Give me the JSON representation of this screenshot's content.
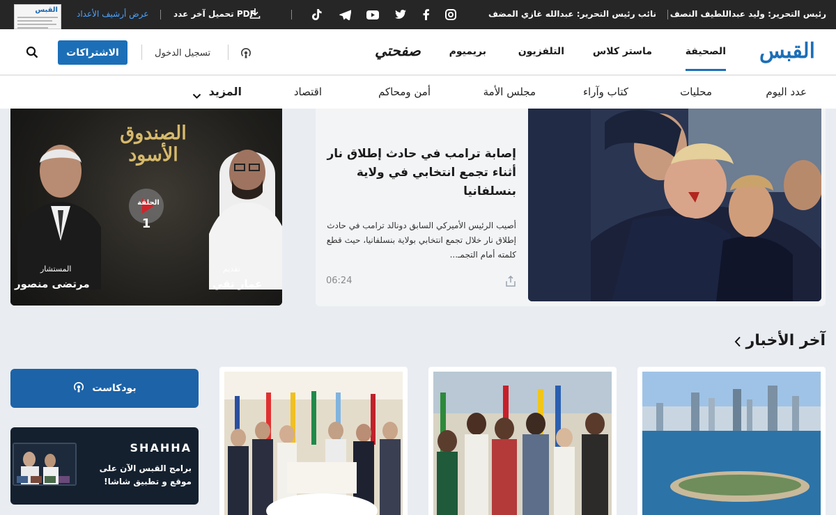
{
  "topbar": {
    "editor_in_chief": "رئيس التحرير: وليد عبداللطيف النصف",
    "deputy_editor": "نائب رئيس التحرير: عبدالله غازي المضف",
    "download_pdf": "تحميل آخر عدد PDF",
    "archive": "عرض أرشيف الأعداد",
    "paper_thumb_text": "القبس"
  },
  "header": {
    "logo": "القبس",
    "nav": [
      "الصحيفة",
      "ماستر كلاس",
      "التلفزيون",
      "بريميوم"
    ],
    "safhati": "صفحتي",
    "login": "تسجيل الدخول",
    "subscribe": "الاشتراكات"
  },
  "subnav": {
    "items": [
      "عدد اليوم",
      "محليات",
      "كتاب وآراء",
      "مجلس الأمة",
      "أمن ومحاكم",
      "اقتصاد"
    ],
    "more": "المزيد"
  },
  "promo": {
    "title_line1": "الصندوق",
    "title_line2": "الأسود",
    "episode_label": "الحلقة",
    "episode_number": "1",
    "host_caption": "تقديم",
    "host_name": "عمار تقي",
    "guest_caption": "المستشار",
    "guest_name": "مرتضى منصور"
  },
  "hero": {
    "title": "إصابة ترامب في حادث إطلاق نار أثناء تجمع انتخابي في ولاية بنسلفانيا",
    "summary": "أصيب الرئيس الأميركي السابق دونالد ترامب في حادث إطلاق نار خلال تجمع انتخابي بولاية بنسلفانيا، حيث قطع كلمته أمام التجمـ...",
    "time": "06:24"
  },
  "latest": {
    "title": "آخر الأخبار"
  },
  "sidebar": {
    "podcast": "بودكاست",
    "shasha_brand": "SHAHHA",
    "shasha_text": "برامج القبس الآن على موقع و تطبيق شاشا!"
  },
  "colors": {
    "brand_blue": "#1c6fb7",
    "topbar": "#262626",
    "page_bg": "#e9ecf1"
  }
}
